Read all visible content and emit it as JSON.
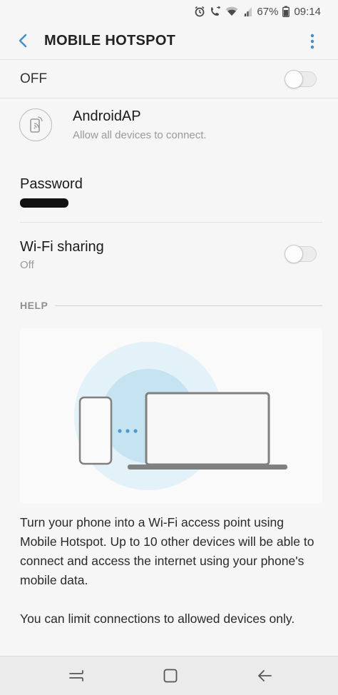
{
  "status_bar": {
    "battery_percent": "67%",
    "time": "09:14",
    "icons": [
      "alarm-icon",
      "call-forwarding-icon",
      "wifi-icon",
      "signal-icon",
      "battery-icon"
    ]
  },
  "app_bar": {
    "title": "MOBILE HOTSPOT",
    "back_icon": "back-arrow-icon",
    "more_icon": "more-options-icon"
  },
  "master_switch": {
    "label": "OFF",
    "enabled": false
  },
  "network": {
    "name": "AndroidAP",
    "description": "Allow all devices to connect.",
    "icon": "device-share-icon"
  },
  "password": {
    "label": "Password"
  },
  "wifi_sharing": {
    "label": "Wi-Fi sharing",
    "status": "Off",
    "enabled": false
  },
  "help": {
    "title": "HELP",
    "paragraph1": "Turn your phone into a Wi-Fi access point using Mobile Hotspot. Up to 10 other devices will be able to connect and access the internet using your phone's mobile data.",
    "paragraph2": "You can limit connections to allowed devices only."
  },
  "nav_bar": {
    "icons": [
      "recents-icon",
      "home-icon",
      "back-icon"
    ]
  },
  "colors": {
    "accent": "#3d8fc4",
    "background": "#f6f6f6",
    "halo_outer": "#e3f1f9",
    "halo_inner": "#c6e3f2"
  }
}
